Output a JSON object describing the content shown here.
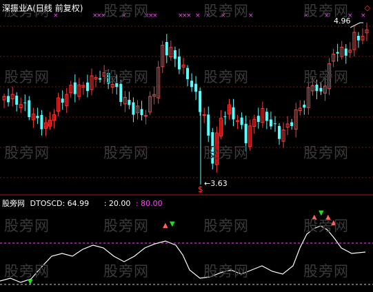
{
  "header": {
    "stock_title": "深振业A",
    "mode": "(日线 前复权)"
  },
  "price_panel": {
    "high_label": "4.96",
    "low_label": "3.63",
    "low_marker": "$",
    "up_color": "#ff3b3b",
    "down_color": "#54ffff",
    "signal_color": "#ff44ff"
  },
  "indicator_panel": {
    "source": "股旁网",
    "name": "DTOSCD: 64.99",
    "level1": ": 20.00",
    "level2": ": 80.00",
    "line_color": "#ffffff",
    "level_color": "#ff44ff"
  },
  "watermarks": [
    "股旁网",
    "股旁网",
    "股旁网",
    "股旁网",
    "股旁网",
    "股旁网",
    "股旁网",
    "股旁网",
    "股旁网",
    "股旁网",
    "股旁网",
    "股旁网"
  ],
  "corner_marker": "◇"
}
